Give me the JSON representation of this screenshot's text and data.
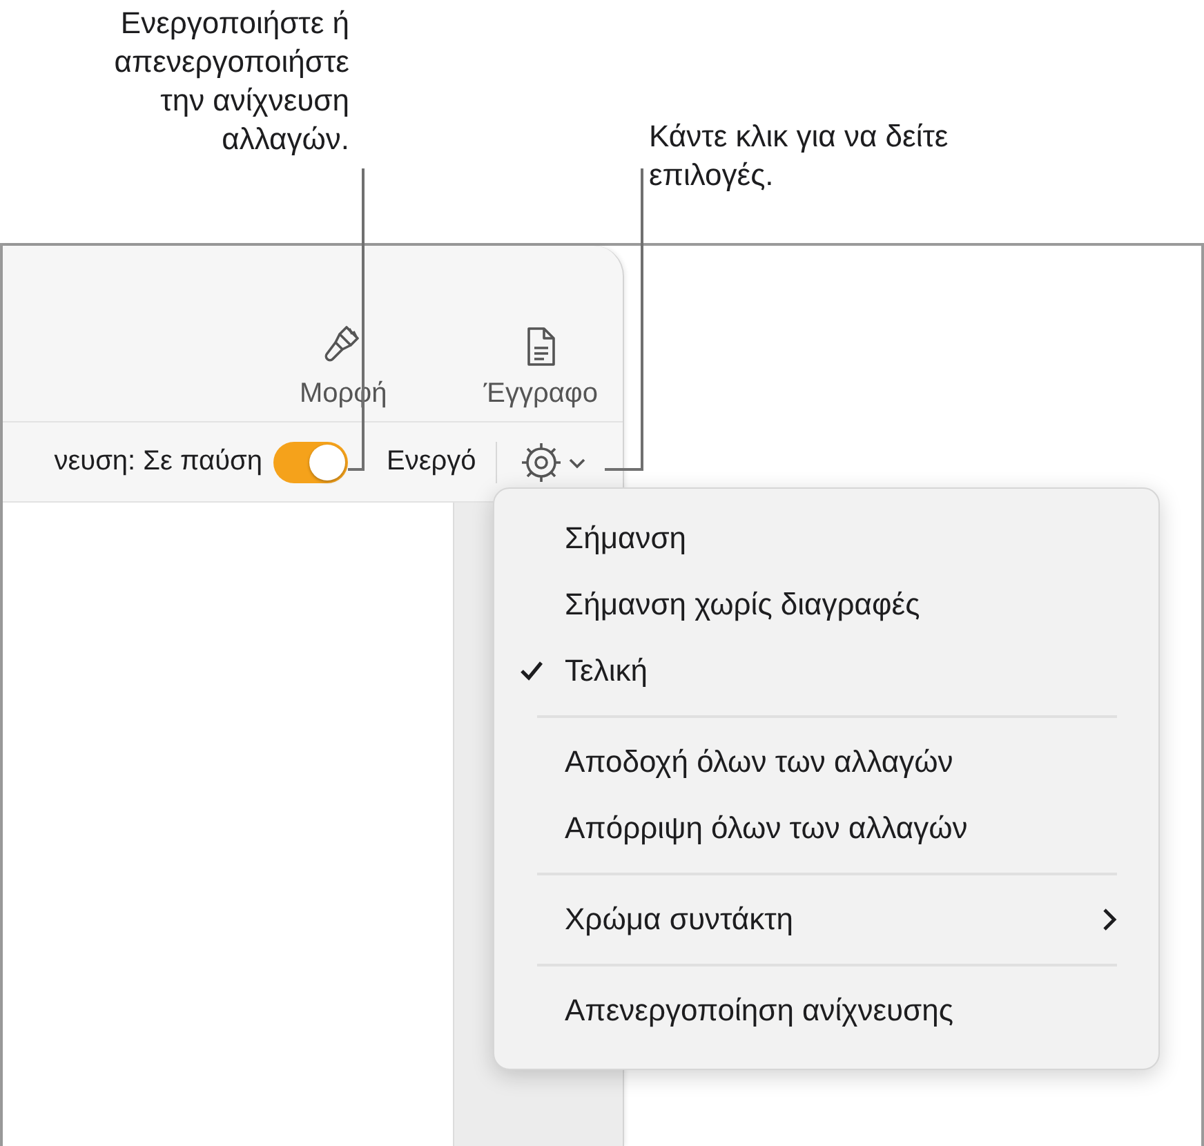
{
  "callouts": [
    {
      "text": "Ενεργοποιήστε ή απενεργοποιήστε την ανίχνευση αλλαγών."
    },
    {
      "text": "Κάντε κλικ για να δείτε επιλογές."
    }
  ],
  "toolbar": {
    "buttons": [
      {
        "kind": "brush",
        "label": "Μορφή"
      },
      {
        "kind": "document",
        "label": "Έγγραφο"
      }
    ]
  },
  "tracking_bar": {
    "status_label": "νευση: Σε παύση",
    "toggle": {
      "on": true
    },
    "on_label": "Ενεργό"
  },
  "menu": {
    "items": [
      {
        "kind": "item",
        "label": "Σήμανση",
        "checked": false
      },
      {
        "kind": "item",
        "label": "Σήμανση χωρίς διαγραφές",
        "checked": false
      },
      {
        "kind": "item",
        "label": "Τελική",
        "checked": true
      },
      {
        "kind": "separator"
      },
      {
        "kind": "item",
        "label": "Αποδοχή όλων των αλλαγών",
        "checked": false
      },
      {
        "kind": "item",
        "label": "Απόρριψη όλων των αλλαγών",
        "checked": false
      },
      {
        "kind": "separator"
      },
      {
        "kind": "submenu",
        "label": "Χρώμα συντάκτη",
        "checked": false
      },
      {
        "kind": "separator"
      },
      {
        "kind": "item",
        "label": "Απενεργοποίηση ανίχνευσης",
        "checked": false
      }
    ]
  }
}
